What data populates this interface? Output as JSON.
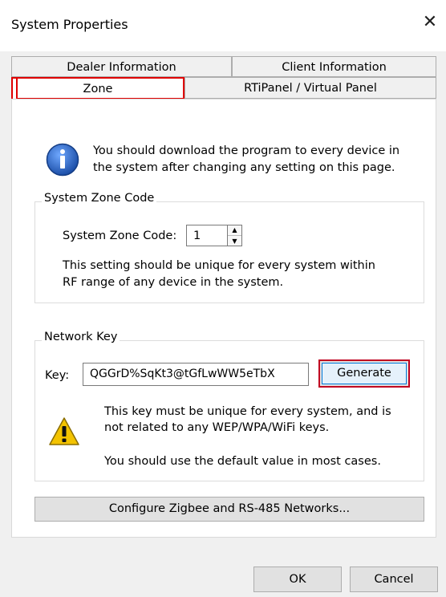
{
  "window": {
    "title": "System Properties",
    "close_glyph": "✕"
  },
  "tabs": {
    "row1": [
      "Dealer Information",
      "Client Information"
    ],
    "row2": [
      "Zone",
      "RTiPanel / Virtual Panel"
    ],
    "active": "Zone"
  },
  "info": {
    "icon": "info-icon",
    "line1": "You should download the program to every device in",
    "line2": "the system after changing any setting on this page."
  },
  "zone_group": {
    "legend": "System Zone Code",
    "label": "System Zone Code:",
    "value": "1",
    "note1": "This setting should be unique for every system within",
    "note2": "RF range of any device in the system."
  },
  "network_group": {
    "legend": "Network Key",
    "key_label": "Key:",
    "key_value": "QGGrD%SqKt3@tGfLwWW5eTbX",
    "generate_label": "Generate",
    "warn_icon": "warning-icon",
    "note1": "This key must be unique for every system, and is",
    "note2": "not related to any WEP/WPA/WiFi keys.",
    "note3": "You should use the default value in most cases."
  },
  "configure_label": "Configure Zigbee and RS-485 Networks...",
  "footer": {
    "ok_label": "OK",
    "cancel_label": "Cancel"
  },
  "colors": {
    "highlight": "#e00000",
    "info_blue": "#1c5fb8",
    "warning_yellow": "#f3c300"
  }
}
